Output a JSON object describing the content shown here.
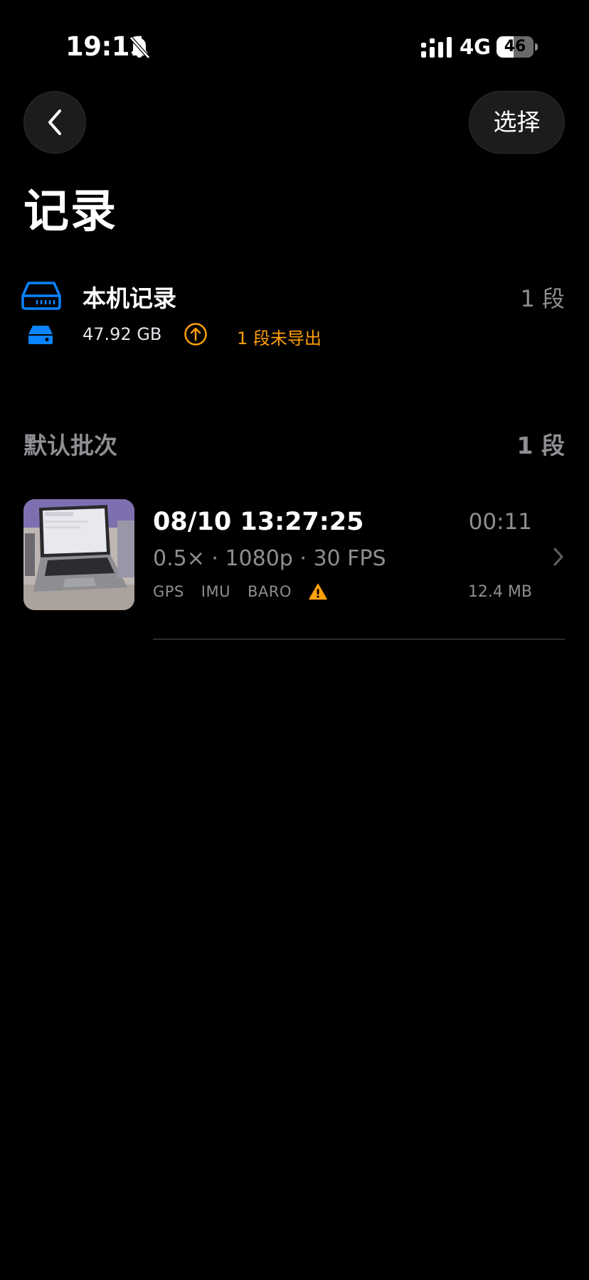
{
  "status_bar": {
    "time": "19:11",
    "network": "4G",
    "battery": "46",
    "battery_level": 0.46
  },
  "nav": {
    "select_label": "选择"
  },
  "page": {
    "title": "记录"
  },
  "storage": {
    "title": "本机记录",
    "count": "1 段",
    "size": "47.92 GB",
    "unexported": "1 段未导出",
    "accent_color": "#0a84ff",
    "warning_color": "#ff9f0a"
  },
  "batch": {
    "title": "默认批次",
    "count": "1 段",
    "recordings": [
      {
        "datetime": "08/10 13:27:25",
        "duration": "00:11",
        "specs": "0.5× · 1080p · 30 FPS",
        "sensors": [
          "GPS",
          "IMU",
          "BARO"
        ],
        "size": "12.4 MB",
        "has_warning": true
      }
    ]
  }
}
